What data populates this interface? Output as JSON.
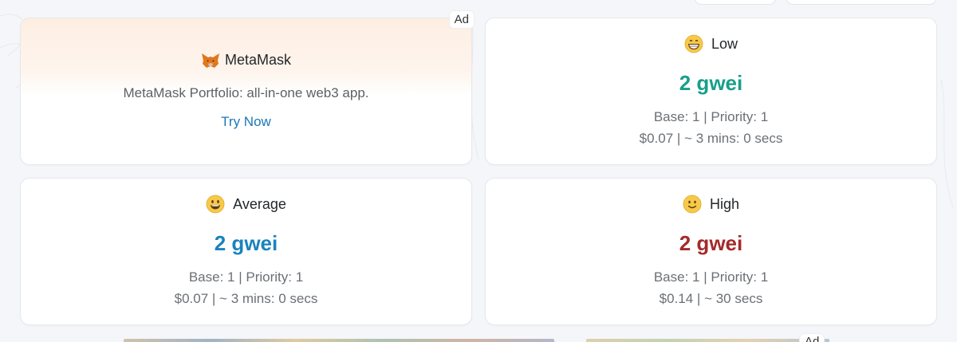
{
  "ad": {
    "badge": "Ad",
    "brand": "MetaMask",
    "description": "MetaMask Portfolio: all-in-one web3 app.",
    "cta": "Try Now",
    "brand_icon": "metamask-fox-icon"
  },
  "tiers": {
    "low": {
      "label": "Low",
      "emoji": "grinning-face-icon",
      "price": "2 gwei",
      "base_priority": "Base: 1 | Priority: 1",
      "cost_time": "$0.07 | ~ 3 mins: 0 secs",
      "color": "#189f8b"
    },
    "average": {
      "label": "Average",
      "emoji": "smiling-face-icon",
      "price": "2 gwei",
      "base_priority": "Base: 1 | Priority: 1",
      "cost_time": "$0.07 | ~ 3 mins: 0 secs",
      "color": "#1a83bd"
    },
    "high": {
      "label": "High",
      "emoji": "slightly-smiling-face-icon",
      "price": "2 gwei",
      "base_priority": "Base: 1 | Priority: 1",
      "cost_time": "$0.14 | ~ 30 secs",
      "color": "#a52a2a"
    }
  },
  "bottom_ad": {
    "badge": "Ad"
  }
}
